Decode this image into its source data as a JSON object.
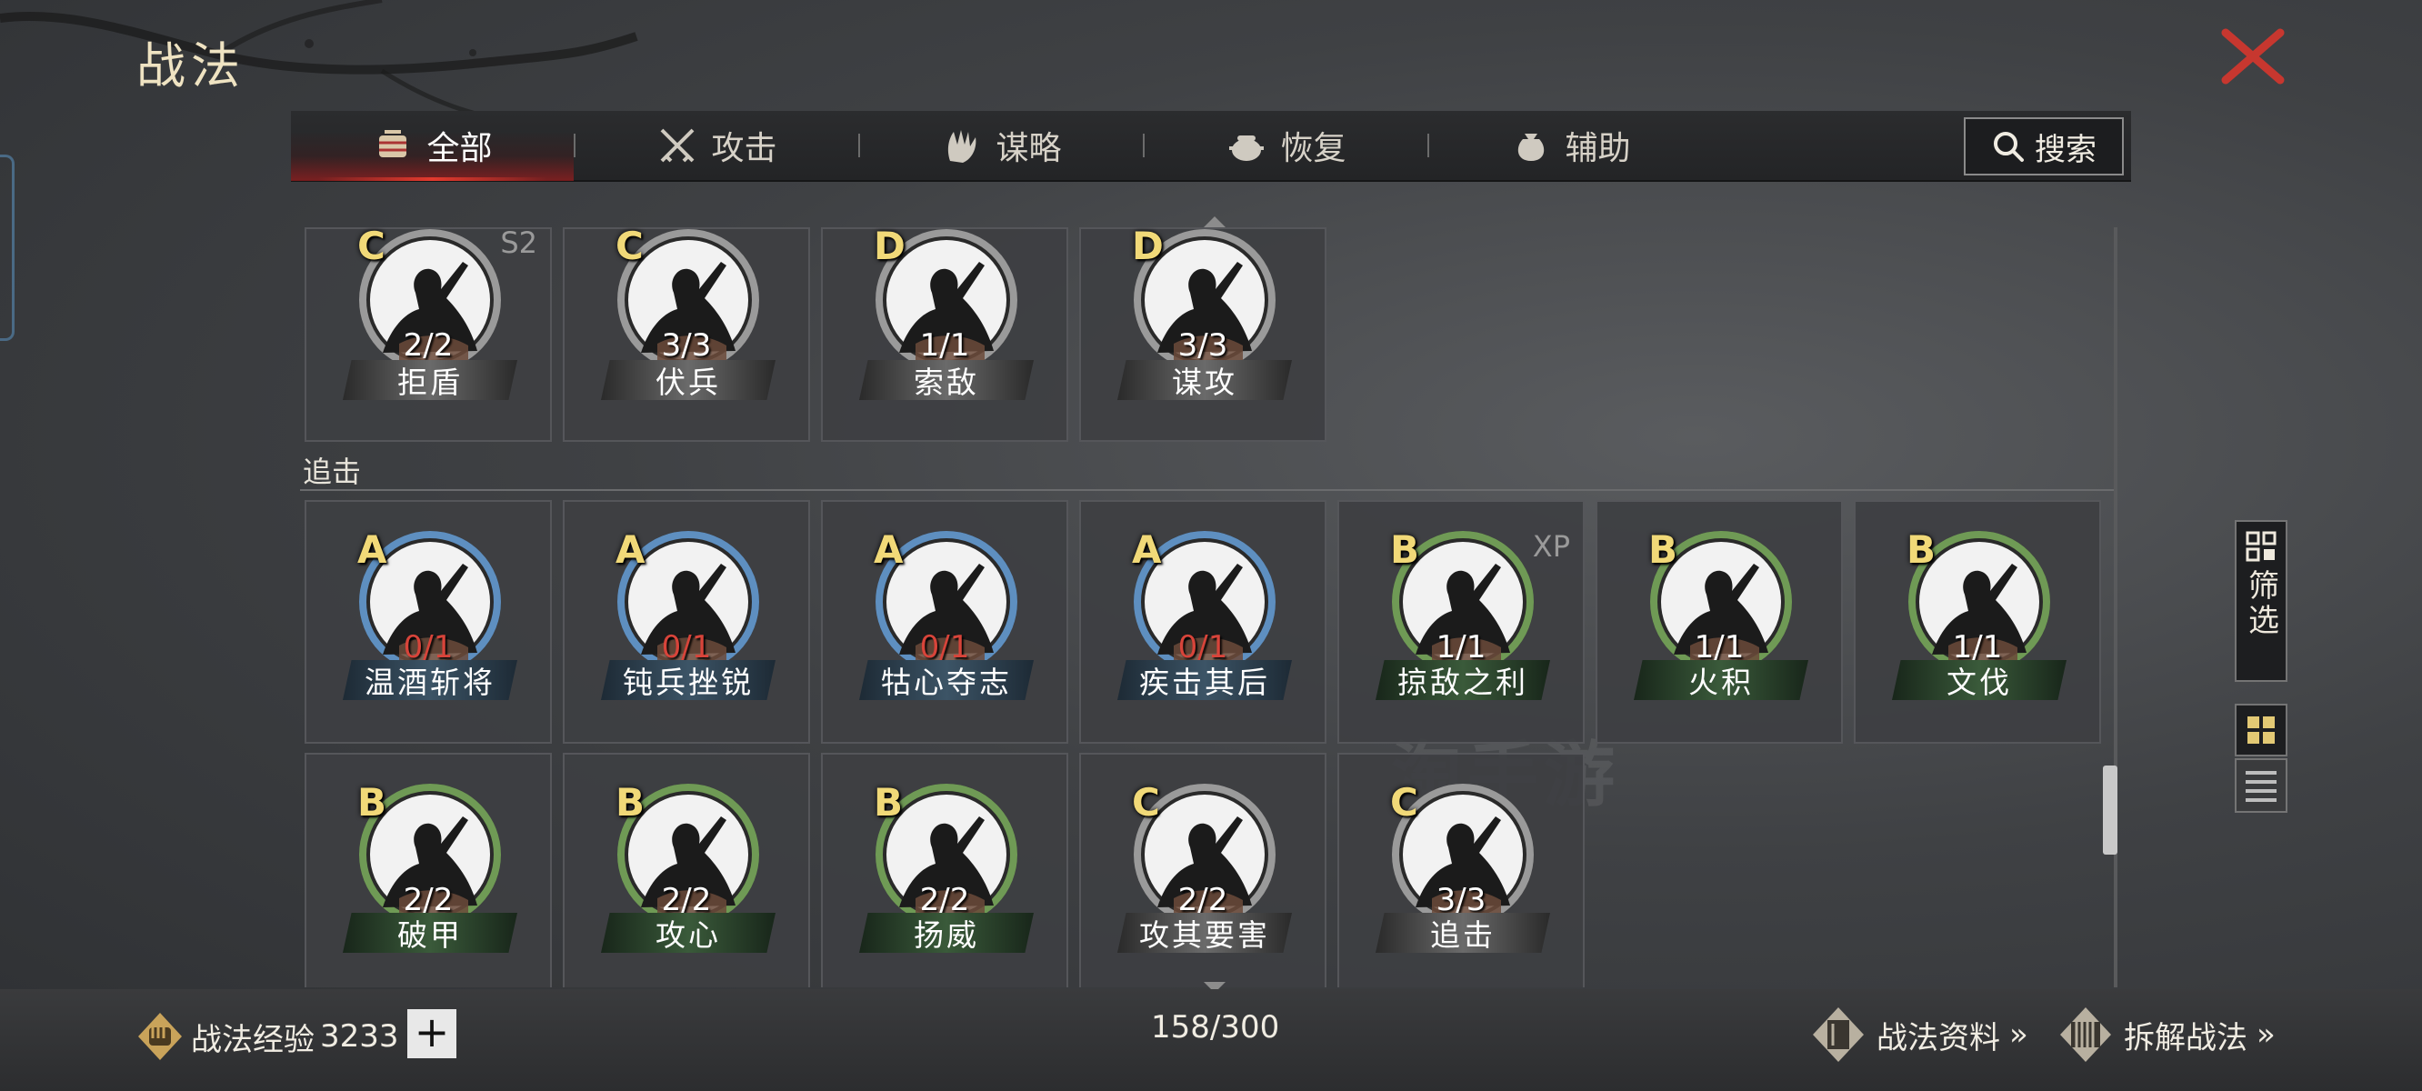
{
  "page": {
    "title": "战法"
  },
  "tabs": [
    {
      "label": "全部",
      "icon": "bundle-icon",
      "active": true
    },
    {
      "label": "攻击",
      "icon": "crossed-swords-icon",
      "active": false
    },
    {
      "label": "谋略",
      "icon": "hand-icon",
      "active": false
    },
    {
      "label": "恢复",
      "icon": "pot-icon",
      "active": false
    },
    {
      "label": "辅助",
      "icon": "bag-icon",
      "active": false
    }
  ],
  "search": {
    "label": "搜索"
  },
  "cards_top": [
    {
      "grade": "C",
      "tag": "S2",
      "count": "2/2",
      "name": "拒盾",
      "ring": "gray",
      "red": false
    },
    {
      "grade": "C",
      "tag": "",
      "count": "3/3",
      "name": "伏兵",
      "ring": "gray",
      "red": false
    },
    {
      "grade": "D",
      "tag": "",
      "count": "1/1",
      "name": "索敌",
      "ring": "gray",
      "red": false
    },
    {
      "grade": "D",
      "tag": "",
      "count": "3/3",
      "name": "谋攻",
      "ring": "gray",
      "red": false
    }
  ],
  "section": {
    "label": "追击"
  },
  "cards_row1": [
    {
      "grade": "A",
      "tag": "",
      "count": "0/1",
      "name": "温酒斩将",
      "ring": "blue",
      "red": true
    },
    {
      "grade": "A",
      "tag": "",
      "count": "0/1",
      "name": "钝兵挫锐",
      "ring": "blue",
      "red": true
    },
    {
      "grade": "A",
      "tag": "",
      "count": "0/1",
      "name": "牯心夺志",
      "ring": "blue",
      "red": true
    },
    {
      "grade": "A",
      "tag": "",
      "count": "0/1",
      "name": "疾击其后",
      "ring": "blue",
      "red": true
    },
    {
      "grade": "B",
      "tag": "XP",
      "count": "1/1",
      "name": "掠敌之利",
      "ring": "green",
      "red": false
    },
    {
      "grade": "B",
      "tag": "",
      "count": "1/1",
      "name": "火积",
      "ring": "green",
      "red": false
    },
    {
      "grade": "B",
      "tag": "",
      "count": "1/1",
      "name": "文伐",
      "ring": "green",
      "red": false
    }
  ],
  "cards_row2": [
    {
      "grade": "B",
      "tag": "",
      "count": "2/2",
      "name": "破甲",
      "ring": "green",
      "red": false
    },
    {
      "grade": "B",
      "tag": "",
      "count": "2/2",
      "name": "攻心",
      "ring": "green",
      "red": false
    },
    {
      "grade": "B",
      "tag": "",
      "count": "2/2",
      "name": "扬威",
      "ring": "green",
      "red": false
    },
    {
      "grade": "C",
      "tag": "",
      "count": "2/2",
      "name": "攻其要害",
      "ring": "gray",
      "red": false
    },
    {
      "grade": "C",
      "tag": "",
      "count": "3/3",
      "name": "追击",
      "ring": "gray",
      "red": false
    }
  ],
  "side": {
    "filter_label": "筛选"
  },
  "bottom": {
    "exp_label": "战法经验",
    "exp_value": "3233",
    "plus": "+",
    "capacity": "158/300",
    "link1": "战法资料",
    "link2": "拆解战法",
    "chevron": "»"
  },
  "colors": {
    "ring_blue": "#5e8fc0",
    "ring_green": "#6f9a55",
    "ring_gray": "#9a9a9a",
    "accent_red": "#e23a2e",
    "grade_gold": "#f1d978"
  }
}
